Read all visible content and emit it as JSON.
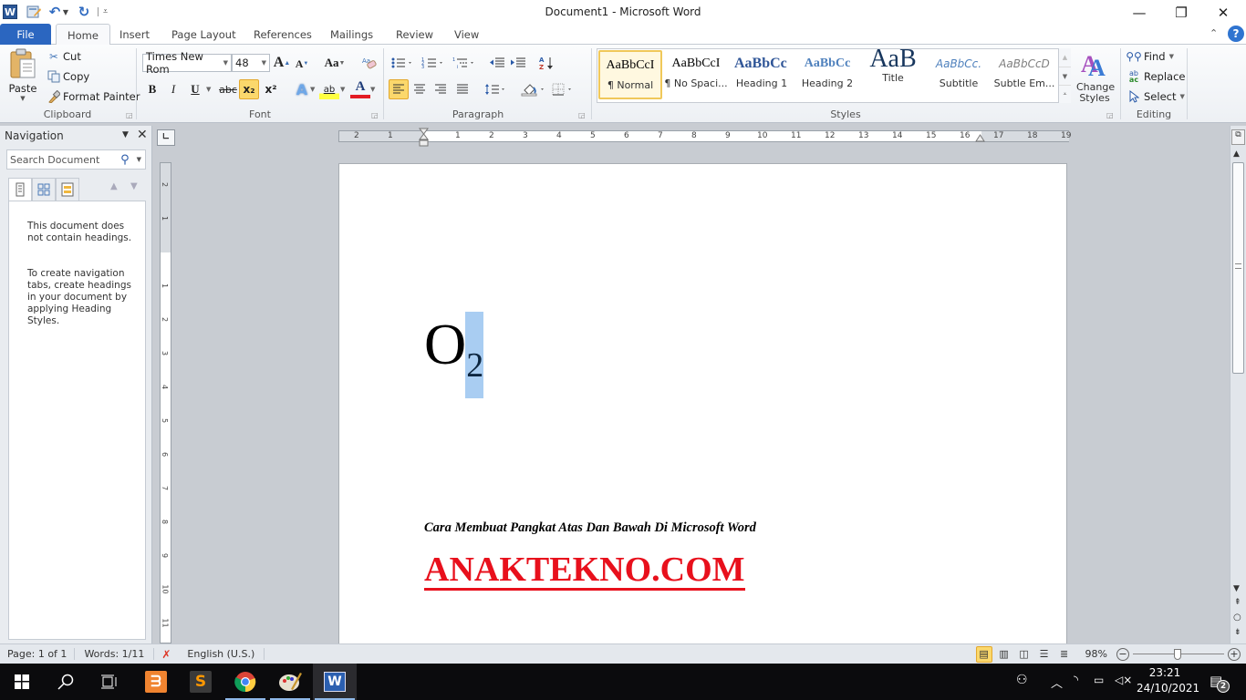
{
  "window": {
    "title": "Document1  -  Microsoft Word",
    "controls": {
      "minimize": "—",
      "restore": "❐",
      "close": "✕"
    }
  },
  "quick_access": {
    "word_icon": "W",
    "save_icon": "save-icon",
    "undo_icon": "undo-icon",
    "redo_icon": "redo-icon",
    "customize_icon": "customize-icon"
  },
  "tabs": [
    {
      "label": "File"
    },
    {
      "label": "Home"
    },
    {
      "label": "Insert"
    },
    {
      "label": "Page Layout"
    },
    {
      "label": "References"
    },
    {
      "label": "Mailings"
    },
    {
      "label": "Review"
    },
    {
      "label": "View"
    }
  ],
  "ribbon": {
    "clipboard": {
      "label": "Clipboard",
      "paste": "Paste",
      "cut": "Cut",
      "copy": "Copy",
      "format_painter": "Format Painter"
    },
    "font": {
      "label": "Font",
      "font_name": "Times New Rom",
      "font_size": "48",
      "grow": "A",
      "shrink": "A",
      "change_case": "Aa",
      "bold": "B",
      "italic": "I",
      "underline": "U",
      "strikethrough": "abc",
      "subscript": "x₂",
      "superscript": "x²",
      "text_effects": "A",
      "highlight": "ab",
      "font_color": "A",
      "font_color_value": "#e31b23",
      "subscript_active": true
    },
    "paragraph": {
      "label": "Paragraph",
      "pilcrow": "¶",
      "align_left_active": true
    },
    "styles": {
      "label": "Styles",
      "items": [
        {
          "sample": "AaBbCcI",
          "name": "¶ Normal",
          "active": true
        },
        {
          "sample": "AaBbCcI",
          "name": "¶ No Spaci..."
        },
        {
          "sample": "AaBbCc",
          "name": "Heading 1"
        },
        {
          "sample": "AaBbCc",
          "name": "Heading 2"
        },
        {
          "sample": "AaB",
          "name": "Title"
        },
        {
          "sample": "AaBbCc.",
          "name": "Subtitle"
        },
        {
          "sample": "AaBbCcD",
          "name": "Subtle Em..."
        }
      ],
      "change_styles": "Change Styles"
    },
    "editing": {
      "label": "Editing",
      "find": "Find",
      "replace": "Replace",
      "select": "Select"
    }
  },
  "navigation": {
    "title": "Navigation",
    "search_placeholder": "Search Document",
    "message1": "This document does not contain headings.",
    "message2": "To create navigation tabs, create headings in your document by applying Heading Styles."
  },
  "ruler": {
    "h_left": [
      "2",
      "1"
    ],
    "h_right": [
      "1",
      "2",
      "3",
      "4",
      "5",
      "6",
      "7",
      "8",
      "9",
      "10",
      "11",
      "12",
      "13",
      "14",
      "15",
      "16",
      "17",
      "18",
      "19"
    ],
    "v_top": [
      "2",
      "1"
    ],
    "v_main": [
      "1",
      "2",
      "3",
      "4",
      "5",
      "6",
      "7",
      "8",
      "9",
      "10",
      "11"
    ]
  },
  "document": {
    "formula_main": "O",
    "formula_sub": "2",
    "subtitle": "Cara Membuat Pangkat Atas Dan Bawah Di Microsoft Word",
    "brand": "ANAKTEKNO.COM",
    "brand_color": "#e8101c"
  },
  "status": {
    "page": "Page: 1 of 1",
    "words": "Words: 1/11",
    "language": "English (U.S.)",
    "zoom": "98%",
    "zoom_level_percent": 98
  },
  "taskbar": {
    "time": "23:21",
    "date": "24/10/2021",
    "notifications": "2",
    "apps": [
      "start",
      "search",
      "task-view",
      "xampp",
      "sublime-text",
      "chrome",
      "paint",
      "word"
    ]
  }
}
